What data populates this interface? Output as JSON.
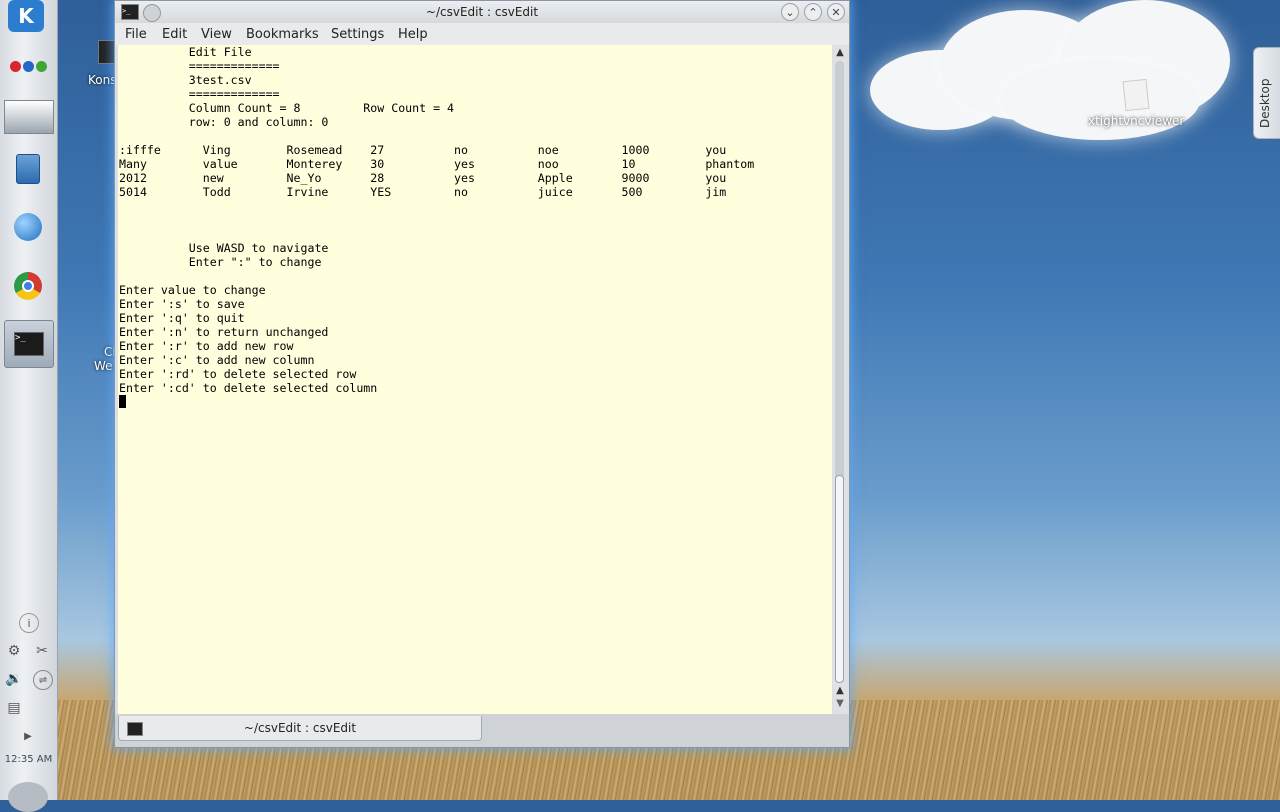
{
  "desktop": {
    "icons": [
      {
        "label": "xtightvncviewer"
      }
    ],
    "partial_labels": {
      "konsole": "Kons",
      "web1": "Cl",
      "web2": "We"
    },
    "desktop_tab": "Desktop"
  },
  "panel": {
    "clock": "12:35 AM"
  },
  "window": {
    "title": "~/csvEdit : csvEdit",
    "menu": [
      "File",
      "Edit",
      "View",
      "Bookmarks",
      "Settings",
      "Help"
    ],
    "terminal_lines": [
      "          Edit File",
      "          =============",
      "          3test.csv",
      "          =============",
      "          Column Count = 8         Row Count = 4",
      "          row: 0 and column: 0",
      "",
      ":ifffe      Ving        Rosemead    27          no          noe         1000        you",
      "Many        value       Monterey    30          yes         noo         10          phantom",
      "2012        new         Ne_Yo       28          yes         Apple       9000        you",
      "5014        Todd        Irvine      YES         no          juice       500         jim",
      "",
      "",
      "",
      "          Use WASD to navigate",
      "          Enter \":\" to change",
      "",
      "Enter value to change",
      "Enter ':s' to save",
      "Enter ':q' to quit",
      "Enter ':n' to return unchanged",
      "Enter ':r' to add new row",
      "Enter ':c' to add new column",
      "Enter ':rd' to delete selected row",
      "Enter ':cd' to delete selected column"
    ],
    "tab_label": "~/csvEdit : csvEdit"
  }
}
